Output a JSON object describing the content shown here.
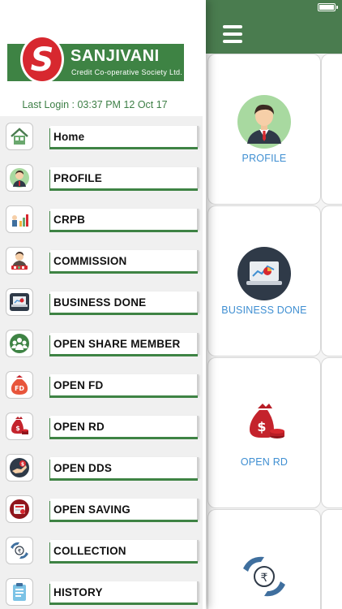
{
  "drawer": {
    "logo": {
      "name": "SANJIVANI",
      "subtitle": "Credit Co-operative Society Ltd.",
      "mark": "S"
    },
    "last_login": "Last Login : 03:37 PM 12 Oct 17",
    "menu": [
      {
        "label": "Home",
        "icon": "home-icon"
      },
      {
        "label": "PROFILE",
        "icon": "user-icon"
      },
      {
        "label": "CRPB",
        "icon": "chart-icon"
      },
      {
        "label": "COMMISSION",
        "icon": "agent-icon"
      },
      {
        "label": "BUSINESS DONE",
        "icon": "laptop-chart-icon"
      },
      {
        "label": "OPEN SHARE MEMBER",
        "icon": "group-icon"
      },
      {
        "label": "OPEN FD",
        "icon": "fd-bag-icon"
      },
      {
        "label": "OPEN RD",
        "icon": "money-bag-icon"
      },
      {
        "label": "OPEN DDS",
        "icon": "hand-coin-icon"
      },
      {
        "label": "OPEN SAVING",
        "icon": "savings-icon"
      },
      {
        "label": "COLLECTION",
        "icon": "collection-icon"
      },
      {
        "label": "HISTORY",
        "icon": "clipboard-icon"
      }
    ]
  },
  "main": {
    "tiles": [
      {
        "label": "PROFILE",
        "icon": "user-avatar-icon"
      },
      {
        "label": "BUSINESS DONE",
        "icon": "laptop-chart-icon"
      },
      {
        "label": "OPEN RD",
        "icon": "money-bag-icon"
      },
      {
        "label": "",
        "icon": "rupee-hands-icon"
      }
    ]
  },
  "colors": {
    "brand_green": "#3e8344",
    "header_green": "#4a7c4f",
    "link_blue": "#3f8fd2",
    "logo_red": "#d7282f"
  }
}
